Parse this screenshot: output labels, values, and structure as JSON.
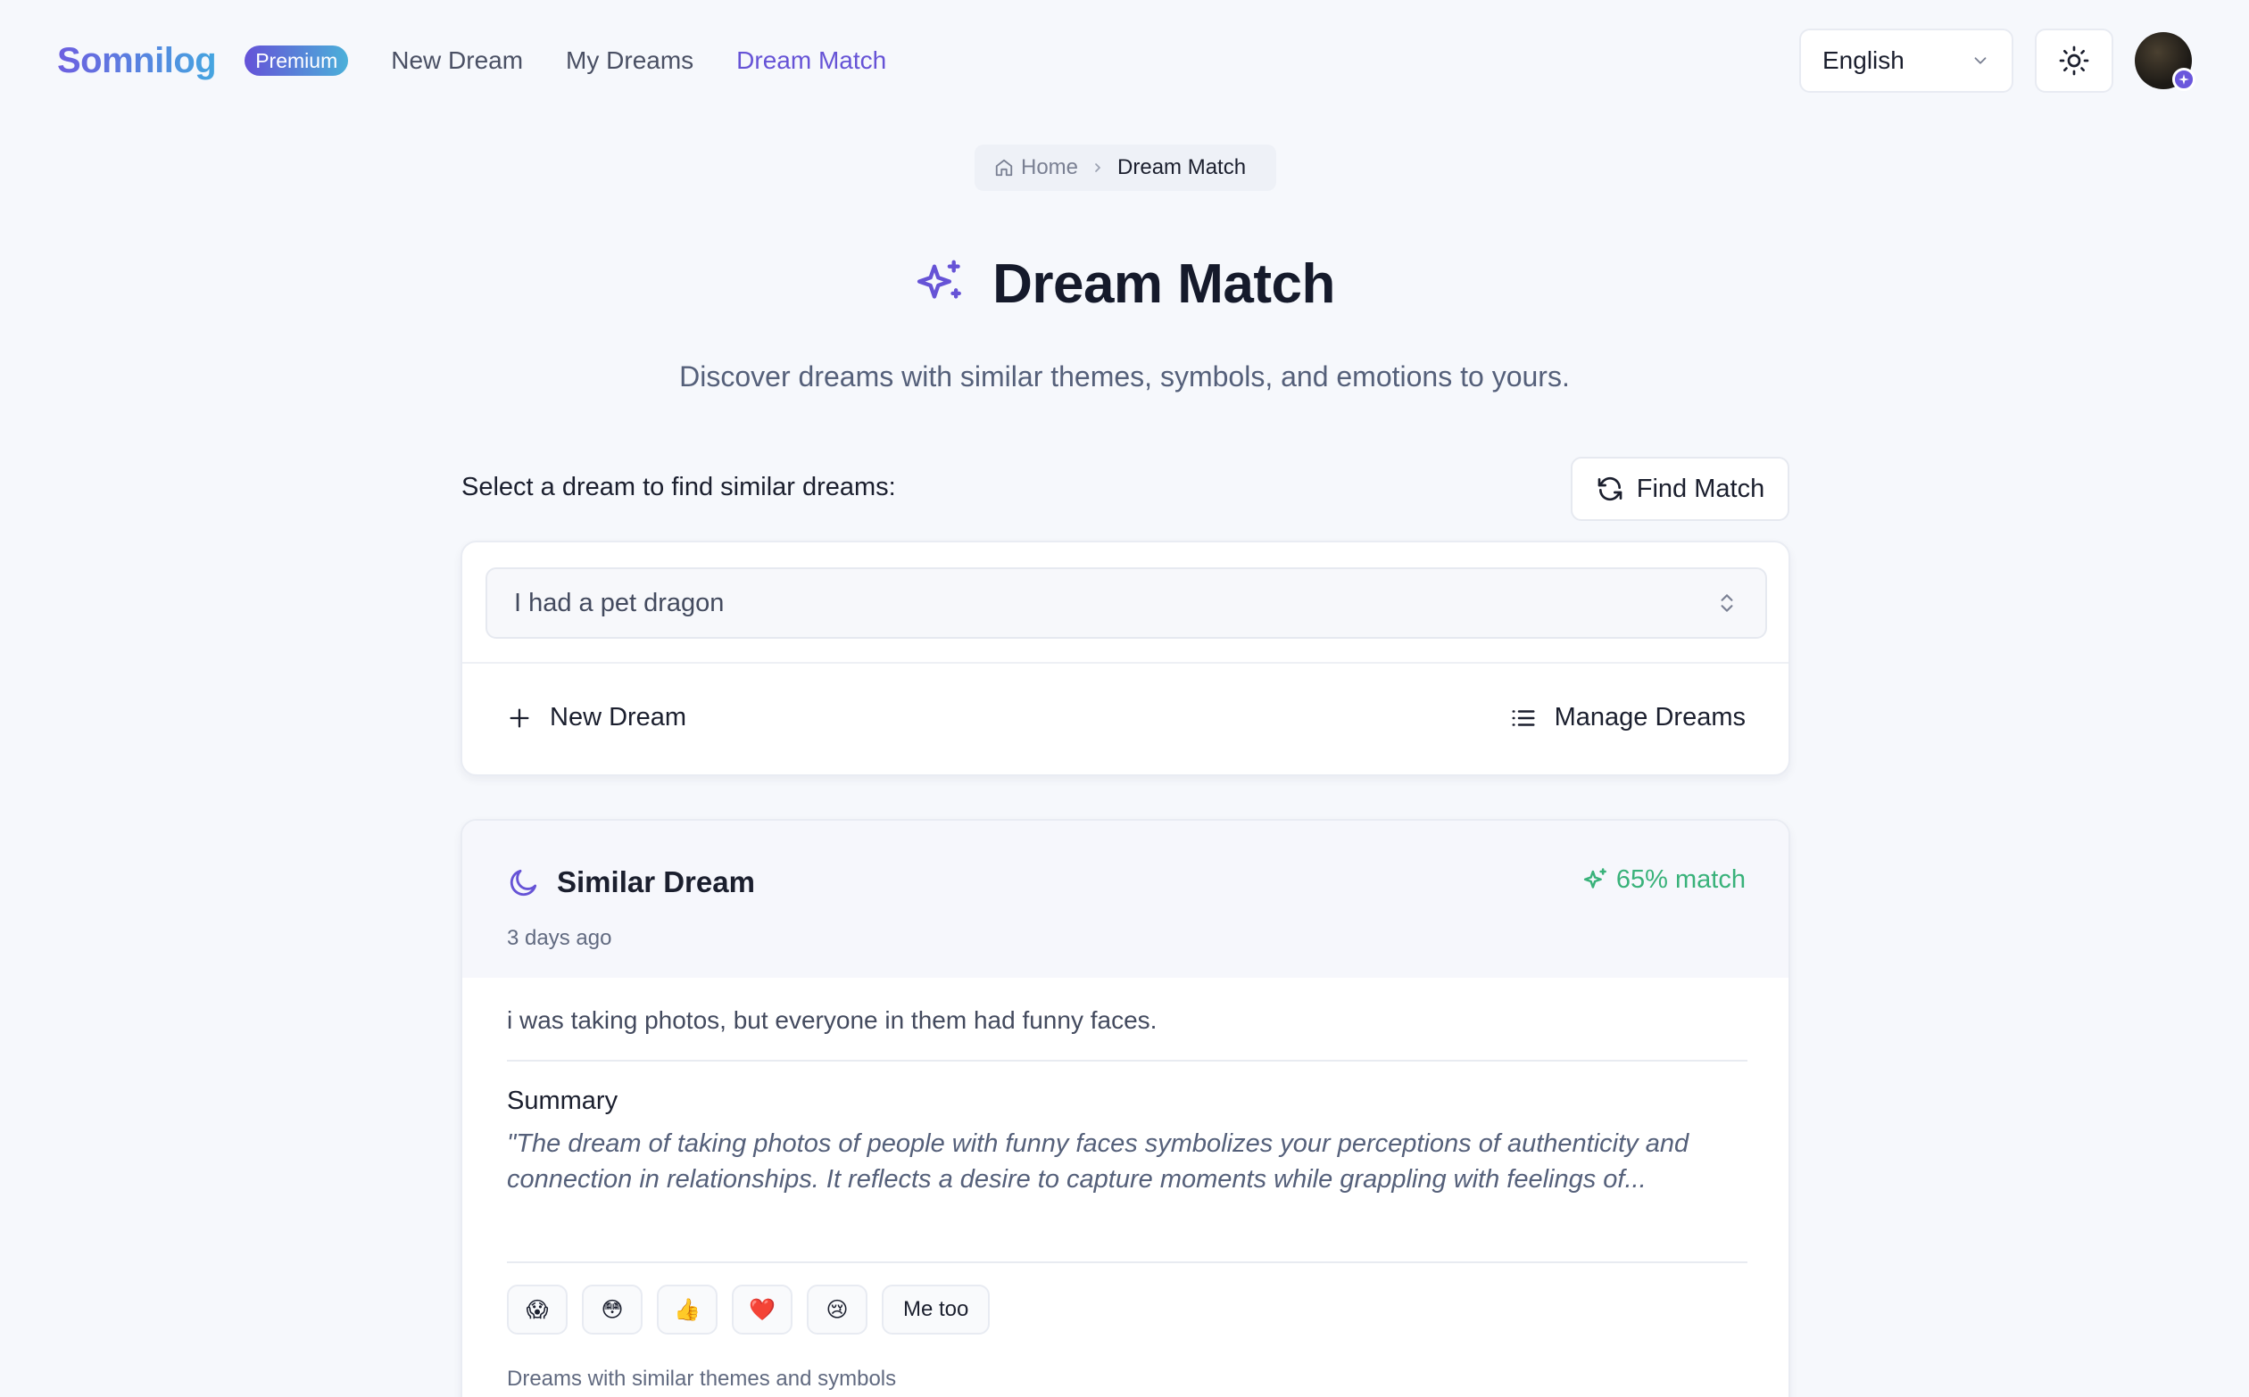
{
  "header": {
    "logo": "Somnilog",
    "badge": "Premium",
    "nav": [
      {
        "label": "New Dream",
        "active": false
      },
      {
        "label": "My Dreams",
        "active": false
      },
      {
        "label": "Dream Match",
        "active": true
      }
    ],
    "language": "English",
    "theme_icon": "sun-icon",
    "avatar_badge_icon": "sparkle-icon"
  },
  "breadcrumb": {
    "home": "Home",
    "current": "Dream Match"
  },
  "page": {
    "title": "Dream Match",
    "title_icon": "sparkles-icon",
    "subtitle": "Discover dreams with similar themes, symbols, and emotions to yours."
  },
  "selector": {
    "label": "Select a dream to find similar dreams:",
    "find_button": "Find Match",
    "selected_dream": "I had a pet dragon",
    "new_dream": "New Dream",
    "manage_dreams": "Manage Dreams"
  },
  "similar": {
    "title": "Similar Dream",
    "match": "65% match",
    "time": "3 days ago",
    "text": "i was taking photos, but everyone in them had funny faces.",
    "summary_label": "Summary",
    "summary": "\"The dream of taking photos of people with funny faces symbolizes your perceptions of authenticity and connection in relationships. It reflects a desire to capture moments while grappling with feelings of...",
    "reactions": [
      "😱",
      "😳",
      "👍",
      "❤️",
      "😢"
    ],
    "me_too": "Me too",
    "footer": "Dreams with similar themes and symbols"
  },
  "colors": {
    "accent": "#6653d6",
    "match_green": "#39b27a",
    "background": "#f6f8fc"
  }
}
